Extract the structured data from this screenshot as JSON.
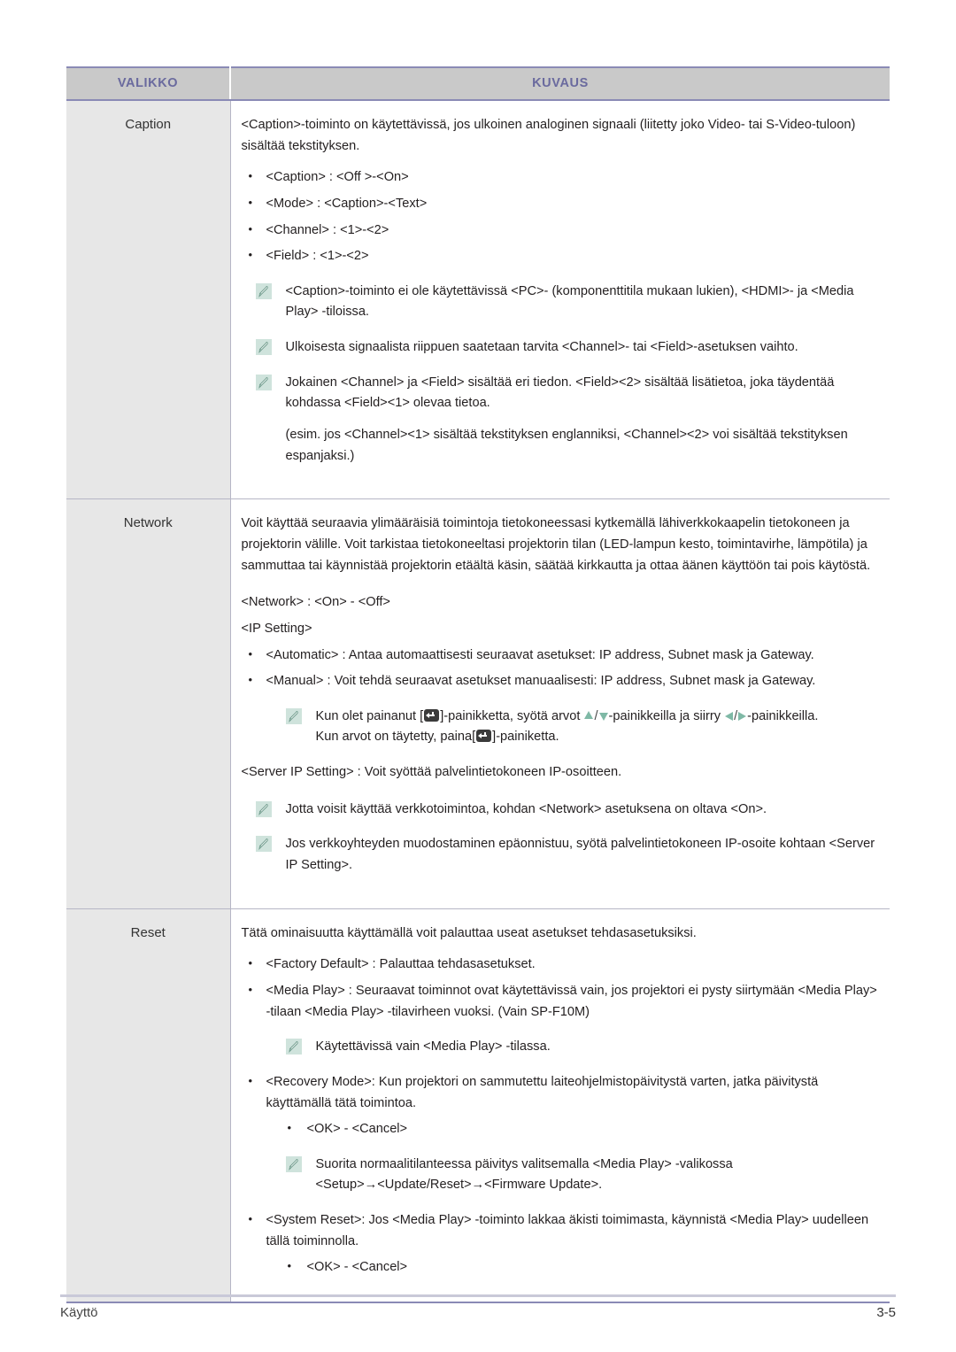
{
  "table": {
    "headers": {
      "menu": "VALIKKO",
      "description": "KUVAUS"
    },
    "rows": [
      {
        "menu": "Caption",
        "intro": "<Caption>-toiminto on käytettävissä, jos ulkoinen analoginen signaali (liitetty joko Video- tai S-Video-tuloon) sisältää tekstityksen.",
        "bullets": [
          "<Caption> : <Off >-<On>",
          "<Mode> : <Caption>-<Text>",
          "<Channel> : <1>-<2>",
          "<Field> : <1>-<2>"
        ],
        "notes": [
          "<Caption>-toiminto ei ole käytettävissä <PC>- (komponenttitila mukaan lukien), <HDMI>- ja <Media Play> -tiloissa.",
          "Ulkoisesta signaalista riippuen saatetaan tarvita <Channel>- tai <Field>-asetuksen vaihto."
        ],
        "note_multi": {
          "line1": "Jokainen <Channel> ja <Field> sisältää eri tiedon. <Field><2> sisältää lisätietoa, joka täydentää kohdassa <Field><1> olevaa tietoa.",
          "line2": "(esim. jos <Channel><1> sisältää tekstityksen englanniksi, <Channel><2> voi sisältää tekstityksen espanjaksi.)"
        }
      },
      {
        "menu": "Network",
        "intro": "Voit käyttää seuraavia ylimääräisiä toimintoja tietokoneessasi kytkemällä lähiverkkokaapelin tietokoneen ja projektorin välille. Voit tarkistaa tietokoneeltasi projektorin tilan (LED-lampun kesto, toimintavirhe, lämpötila) ja sammuttaa tai käynnistää projektorin etäältä käsin, säätää kirkkautta ja ottaa äänen käyttöön tai pois käytöstä.",
        "network_line": "<Network> : <On> - <Off>",
        "ip_setting_label": "<IP Setting>",
        "bullets": [
          "<Automatic> : Antaa automaattisesti seuraavat asetukset: IP address, Subnet mask ja Gateway.",
          "<Manual> : Voit tehdä seuraavat asetukset manuaalisesti: IP address, Subnet mask ja Gateway."
        ],
        "key_note": {
          "part1": "Kun olet painanut [",
          "part2": "]-painikketta, syötä arvot ",
          "part3": "-painikkeilla ja siirry ",
          "part4": "-painikkeilla.",
          "part5": "Kun arvot on täytetty, paina[",
          "part6": "]-painiketta."
        },
        "server_ip_line": "<Server IP Setting> : Voit syöttää palvelintietokoneen IP-osoitteen.",
        "notes": [
          "Jotta voisit käyttää verkkotoimintoa, kohdan <Network> asetuksena on oltava <On>.",
          "Jos verkkoyhteyden muodostaminen epäonnistuu, syötä palvelintietokoneen IP-osoite kohtaan <Server IP Setting>."
        ]
      },
      {
        "menu": "Reset",
        "intro": "Tätä ominaisuutta käyttämällä voit palauttaa useat asetukset tehdasasetuksiksi.",
        "bullets": [
          "<Factory Default> : Palauttaa tehdasasetukset.",
          "<Media Play> : Seuraavat toiminnot ovat käytettävissä vain, jos projektori ei pysty siirtymään <Media Play> -tilaan <Media Play> -tilavirheen vuoksi. (Vain SP-F10M)"
        ],
        "note_media": "Käytettävissä vain <Media Play> -tilassa.",
        "recovery_bullet": "<Recovery Mode>: Kun projektori on sammutettu laiteohjelmistopäivitystä varten, jatka päivitystä käyttämällä tätä toimintoa.",
        "recovery_sub": "<OK> - <Cancel>",
        "note_firmware": "Suorita normaalitilanteessa päivitys valitsemalla <Media Play> -valikossa <Setup>→<Update/Reset>→<Firmware Update>.",
        "system_reset_bullet": "<System Reset>: Jos <Media Play> -toiminto lakkaa äkisti toimimasta, käynnistä <Media Play> uudelleen tällä toiminnolla.",
        "system_reset_sub": "<OK> - <Cancel>"
      }
    ]
  },
  "footer": {
    "section": "Käyttö",
    "page": "3-5"
  },
  "icons": {
    "note": "note-pencil-icon",
    "enter_key": "enter-key-icon",
    "arrow_up": "arrow-up-icon",
    "arrow_down": "arrow-down-icon",
    "arrow_left": "arrow-left-icon",
    "arrow_right": "arrow-right-icon"
  },
  "colors": {
    "header_bg": "#c9c9c9",
    "header_text": "#6a6a9e",
    "menu_cell_bg": "#e7e7e7",
    "table_border": "#8a8ab5",
    "note_icon_bg": "#cfe3dc",
    "arrow_green": "#7fb9a6"
  }
}
